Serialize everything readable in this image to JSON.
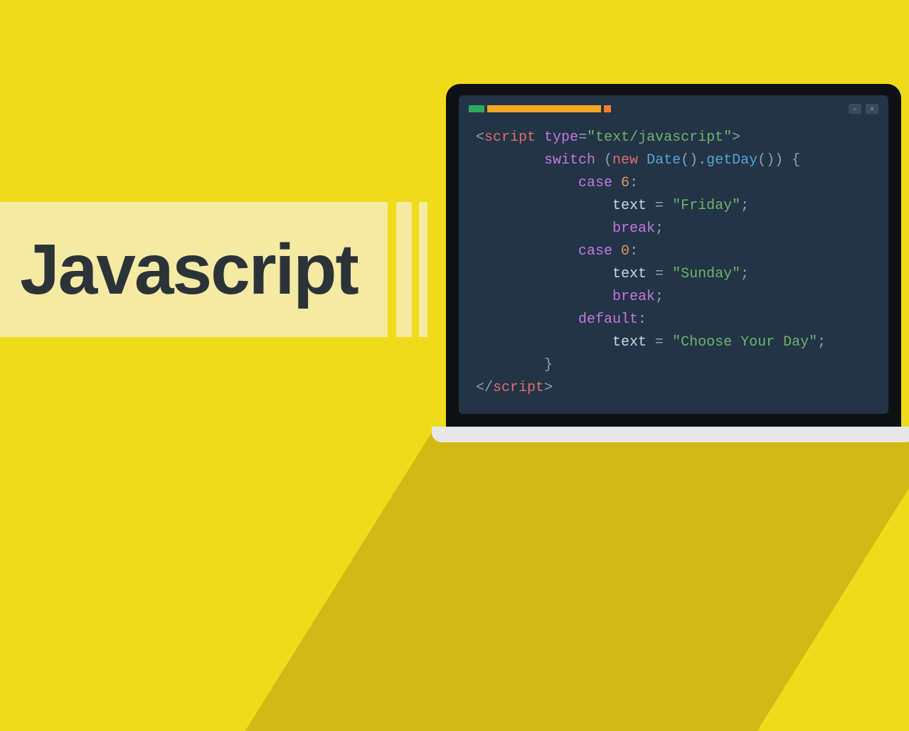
{
  "title": "Javascript",
  "colors": {
    "bg": "#f0db1a",
    "band": "#f4eaa4",
    "shadow": "#d3b916",
    "screen": "#223445",
    "bezel": "#0e1113",
    "base": "#e8e8e8"
  },
  "code": {
    "open_angle": "<",
    "close_angle": ">",
    "slash_open_angle": "</",
    "tag_name": "script",
    "attr_name": "type",
    "eq": "=",
    "attr_value": "\"text/javascript\"",
    "switch_kw": "switch",
    "paren_open": " (",
    "new_kw": "new",
    "date_class": " Date",
    "date_call": "().",
    "getday": "getDay",
    "getday_tail": "()) {",
    "case_kw_1": "case",
    "case_num_1": " 6",
    "colon": ":",
    "text_ident": "text",
    "assign_eq": " = ",
    "friday": "\"Friday\"",
    "semicolon": ";",
    "break_kw": "break",
    "case_kw_2": "case",
    "case_num_2": " 0",
    "sunday": "\"Sunday\"",
    "default_kw": "default",
    "choose_day": "\"Choose Your Day\"",
    "brace_close": "}",
    "indent1": "        ",
    "indent2": "            ",
    "indent3": "                ",
    "indent_brace": "        "
  },
  "window_buttons": {
    "min": "‒",
    "close": "×"
  }
}
